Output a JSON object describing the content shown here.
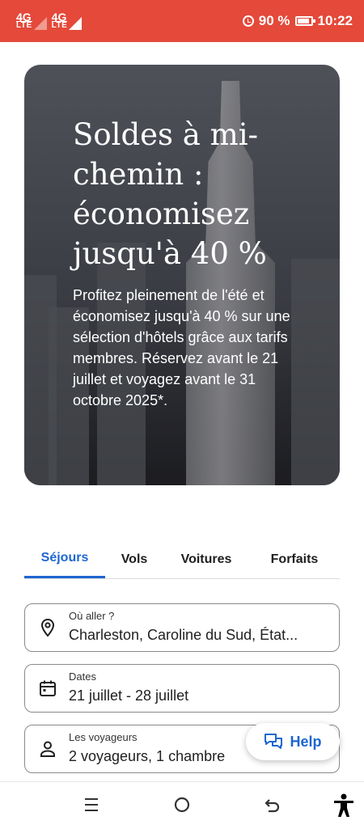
{
  "status_bar": {
    "network1": "4G",
    "network1_sub": "LTE",
    "network2": "4G",
    "network2_sub": "LTE",
    "battery": "90 %",
    "battery_level": 0.9,
    "time": "10:22"
  },
  "hero": {
    "title": "Soldes à mi-chemin : économisez jusqu'à 40 %",
    "body": "Profitez pleinement de l'été et économisez jusqu'à 40 % sur une sélection d'hôtels grâce aux tarifs membres. Réservez avant le 21 juillet et voyagez avant le 31 octobre 2025*."
  },
  "tabs": [
    {
      "label": "Séjours",
      "active": true
    },
    {
      "label": "Vols",
      "active": false
    },
    {
      "label": "Voitures",
      "active": false
    },
    {
      "label": "Forfaits",
      "active": false
    }
  ],
  "search": {
    "destination": {
      "label": "Où aller ?",
      "value": "Charleston, Caroline du Sud, État..."
    },
    "dates": {
      "label": "Dates",
      "value": "21 juillet - 28 juillet"
    },
    "travelers": {
      "label": "Les voyageurs",
      "value": "2 voyageurs, 1 chambre"
    }
  },
  "help": {
    "label": "Help"
  },
  "colors": {
    "status_bar": "#e4493a",
    "accent": "#1e66d0"
  },
  "icons": {
    "destination": "location-pin-icon",
    "dates": "calendar-icon",
    "travelers": "person-icon",
    "help": "chat-icon"
  }
}
